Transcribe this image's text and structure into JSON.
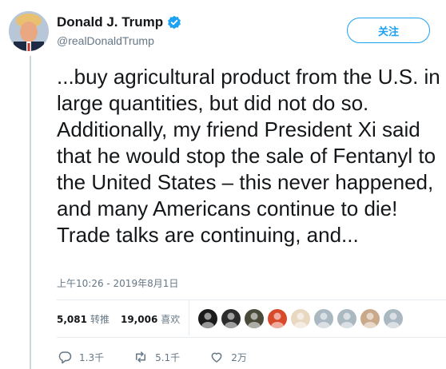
{
  "author": {
    "name": "Donald J. Trump",
    "handle": "@realDonaldTrump",
    "verified": true
  },
  "follow_label": "关注",
  "tweet": {
    "text": "...buy agricultural product from the U.S. in large quantities, but did not do so. Additionally, my friend President Xi said that he would stop the sale of Fentanyl to the United States – this never happened, and many Americans continue to die! Trade talks are continuing, and...",
    "timestamp": "上午10:26 - 2019年8月1日"
  },
  "stats": {
    "retweets": "5,081",
    "retweets_label": "转推",
    "likes": "19,006",
    "likes_label": "喜欢"
  },
  "liker_avatars": [
    "#1a1a1a",
    "#2b2b2b",
    "#4a4a3a",
    "#d94a2a",
    "#e8d8c0",
    "#aab8c2",
    "#aab8c2",
    "#c9a98a",
    "#aab8c2"
  ],
  "actions": {
    "reply_count": "1.3千",
    "retweet_count": "5.1千",
    "like_count": "2万"
  },
  "colors": {
    "accent": "#1da1f2",
    "secondary_text": "#657786",
    "border": "#e6ecf0"
  }
}
